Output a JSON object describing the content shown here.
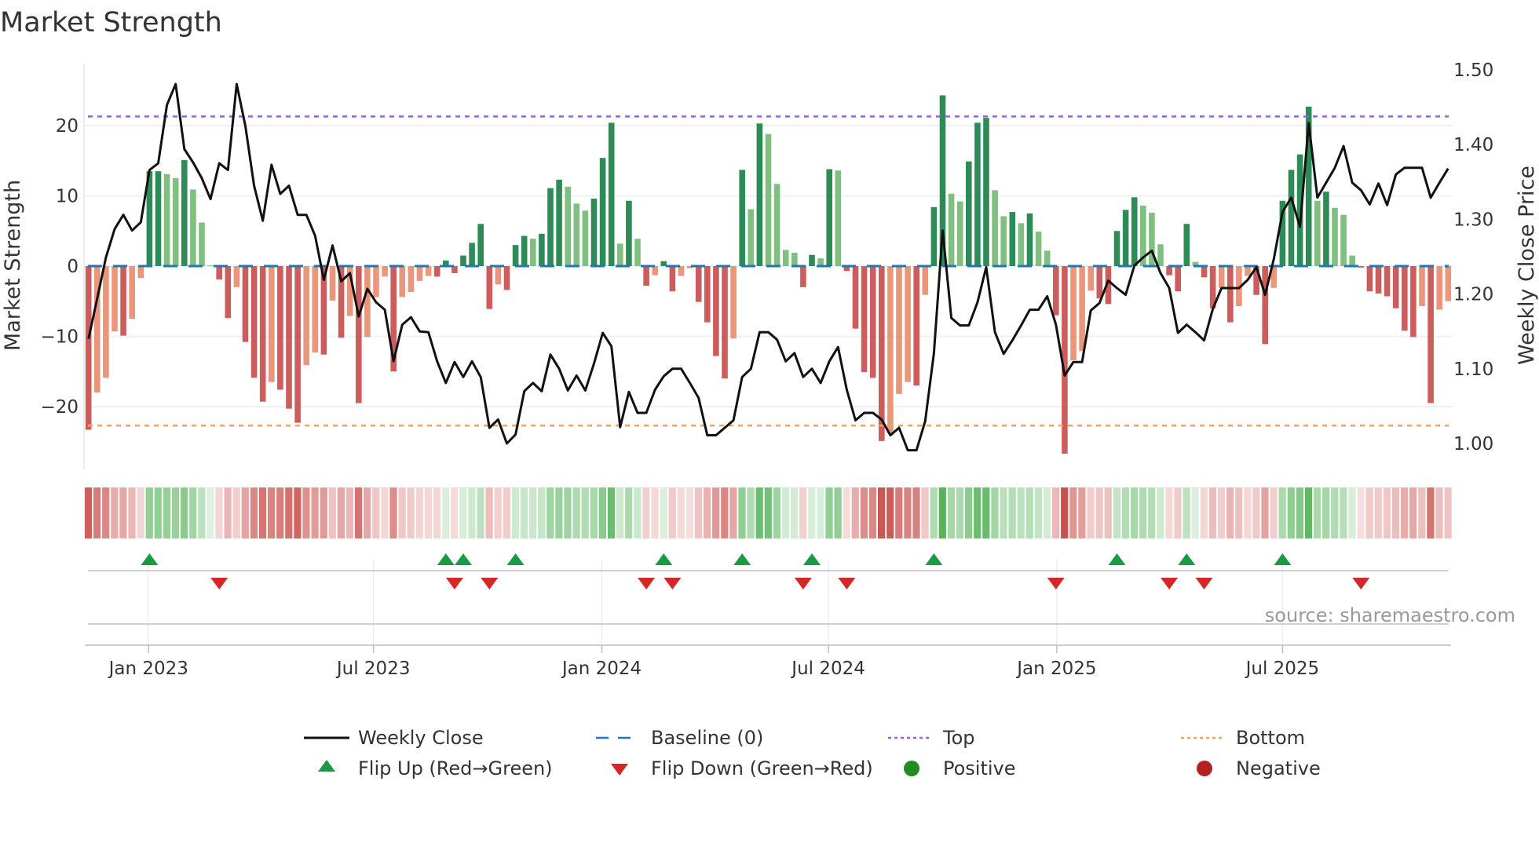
{
  "title": "Market Strength",
  "source": "source: sharemaestro.com",
  "chart_data": {
    "type": "bar+line",
    "title": "Market Strength",
    "ylabel": "Market Strength",
    "y2label": "Weekly Close Price",
    "ylim": [
      -27.5,
      28.5
    ],
    "y2lim": [
      0.95,
      1.5
    ],
    "yticks": [
      "20",
      "10",
      "0",
      "−10",
      "−20"
    ],
    "ytick_values": [
      20,
      10,
      0,
      -10,
      -20
    ],
    "y2ticks": [
      "1.50",
      "1.40",
      "1.30",
      "1.20",
      "1.10",
      "1.00"
    ],
    "y2tick_values": [
      1.5,
      1.4,
      1.3,
      1.2,
      1.1,
      1.0
    ],
    "x_ticks": [
      {
        "label": "Jan 2023",
        "week": 6.9
      },
      {
        "label": "Jul 2023",
        "week": 32.7
      },
      {
        "label": "Jan 2024",
        "week": 58.9
      },
      {
        "label": "Jul 2024",
        "week": 84.9
      },
      {
        "label": "Jan 2025",
        "week": 111.1
      },
      {
        "label": "Jul 2025",
        "week": 137.0
      }
    ],
    "top_level": 21.3,
    "bottom_level": -22.7,
    "baseline": 0,
    "strength": [
      -23.3,
      -18,
      -15.9,
      -9.3,
      -9.9,
      -7.5,
      -1.7,
      13.5,
      13.5,
      13.1,
      12.5,
      15.1,
      10.9,
      6.2,
      0.1,
      -1.9,
      -7.4,
      -3,
      -10.8,
      -15.9,
      -19.3,
      -16.5,
      -17.6,
      -20.3,
      -22.3,
      -14.1,
      -12.3,
      -12.6,
      -4.9,
      -10.2,
      -7.1,
      -19.5,
      -10.1,
      -4.4,
      -1.5,
      -15,
      -4.4,
      -3.7,
      -2.1,
      -1.4,
      -1.5,
      0.8,
      -1,
      1.5,
      3.3,
      6,
      -6.1,
      -2.6,
      -3.4,
      3,
      4.3,
      3.9,
      4.6,
      11.1,
      12.3,
      11.3,
      8.9,
      7.9,
      9.6,
      15.4,
      20.4,
      3.2,
      9.3,
      3.9,
      -2.8,
      -1.3,
      0.7,
      -3.6,
      -1.4,
      -0.3,
      -5.1,
      -8,
      -12.8,
      -16,
      -10.3,
      13.7,
      8.1,
      20.3,
      18.8,
      11.7,
      2.3,
      1.9,
      -3,
      1.6,
      1.1,
      13.8,
      13.6,
      -0.7,
      -8.9,
      -15.1,
      -15.9,
      -24.9,
      -23.8,
      -18.2,
      -16.5,
      -17,
      -4.1,
      8.4,
      24.3,
      10.3,
      9.2,
      14.9,
      20.4,
      21.1,
      10.8,
      7.1,
      7.7,
      6.1,
      7.5,
      4.9,
      2.2,
      -7,
      -26.7,
      -13.4,
      -12.1,
      -3.5,
      -4.6,
      -5.4,
      5,
      8,
      9.8,
      8.6,
      7.6,
      3.1,
      -1.3,
      -3.6,
      6,
      0.6,
      -1.6,
      -6,
      -3.1,
      -8,
      -5.7,
      -1.4,
      -4.1,
      -11.1,
      -3.1,
      9.3,
      13.7,
      15.9,
      22.7,
      9.3,
      10.6,
      8.3,
      7.3,
      1.5,
      -0.2,
      -3.6,
      -3.9,
      -4.3,
      -6,
      -9.2,
      -10.1,
      -5.7,
      -19.5,
      -6.2,
      -5
    ],
    "weekly_close": [
      1.14,
      1.194,
      1.249,
      1.287,
      1.306,
      1.285,
      1.296,
      1.366,
      1.375,
      1.453,
      1.481,
      1.394,
      1.376,
      1.355,
      1.327,
      1.375,
      1.366,
      1.481,
      1.425,
      1.345,
      1.298,
      1.373,
      1.334,
      1.345,
      1.306,
      1.306,
      1.278,
      1.219,
      1.265,
      1.217,
      1.228,
      1.17,
      1.207,
      1.189,
      1.179,
      1.11,
      1.159,
      1.169,
      1.15,
      1.149,
      1.11,
      1.081,
      1.109,
      1.089,
      1.11,
      1.089,
      1.021,
      1.032,
      1.0,
      1.012,
      1.07,
      1.081,
      1.07,
      1.119,
      1.1,
      1.071,
      1.091,
      1.071,
      1.107,
      1.148,
      1.13,
      1.022,
      1.069,
      1.041,
      1.041,
      1.072,
      1.09,
      1.1,
      1.1,
      1.081,
      1.061,
      1.011,
      1.011,
      1.021,
      1.031,
      1.089,
      1.1,
      1.149,
      1.149,
      1.139,
      1.11,
      1.121,
      1.089,
      1.1,
      1.081,
      1.11,
      1.129,
      1.072,
      1.031,
      1.041,
      1.041,
      1.032,
      1.011,
      1.021,
      0.991,
      0.991,
      1.03,
      1.121,
      1.285,
      1.168,
      1.158,
      1.158,
      1.189,
      1.236,
      1.149,
      1.12,
      1.138,
      1.158,
      1.179,
      1.179,
      1.197,
      1.159,
      1.091,
      1.109,
      1.109,
      1.178,
      1.188,
      1.218,
      1.208,
      1.199,
      1.238,
      1.249,
      1.258,
      1.228,
      1.208,
      1.148,
      1.159,
      1.149,
      1.138,
      1.18,
      1.208,
      1.208,
      1.208,
      1.219,
      1.236,
      1.199,
      1.247,
      1.31,
      1.329,
      1.29,
      1.429,
      1.329,
      1.349,
      1.369,
      1.398,
      1.349,
      1.339,
      1.32,
      1.348,
      1.319,
      1.36,
      1.369,
      1.369,
      1.369,
      1.329,
      1.349,
      1.368
    ],
    "legend": {
      "placement": "bottom",
      "items": [
        "Weekly Close",
        "Baseline (0)",
        "Top",
        "Bottom",
        "Flip Up (Red→Green)",
        "Flip Down (Green→Red)",
        "Positive",
        "Negative"
      ]
    },
    "colors": {
      "strong_green": "#2e8b57",
      "weak_green": "#7fbf7f",
      "strong_red": "#cd5c5c",
      "weak_red": "#e9967a",
      "line": "#111111",
      "baseline": "#1f77b4",
      "top": "#9b5de5",
      "bottom": "#f4a261",
      "flip_up": "#1a9a45",
      "flip_down": "#d62728",
      "positive": "#228b22",
      "negative": "#b22222"
    }
  }
}
